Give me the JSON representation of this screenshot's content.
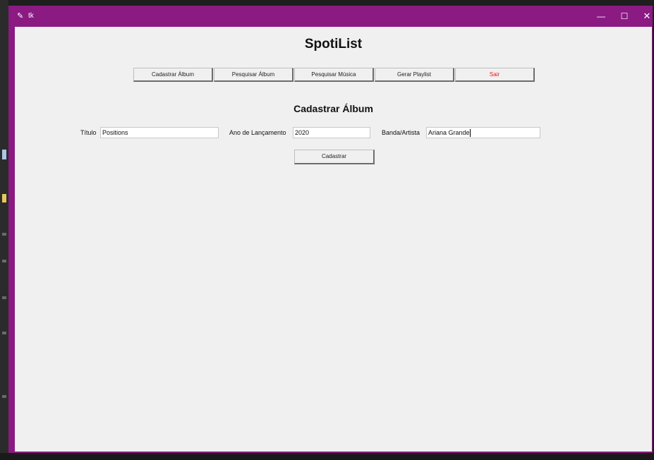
{
  "window": {
    "title": "tk",
    "icon": "feather-icon",
    "controls": {
      "minimize": "—",
      "maximize": "☐",
      "close": "✕"
    },
    "accent": "#8b1a83"
  },
  "app": {
    "title": "SpotiList"
  },
  "nav": {
    "buttons": [
      "Cadastrar Álbum",
      "Pesquisar Álbum",
      "Pesquisar Música",
      "Gerar Playlist",
      "Sair"
    ],
    "exit_color": "#e01818"
  },
  "form": {
    "section_title": "Cadastrar Álbum",
    "fields": [
      {
        "label": "Título",
        "value": "Positions"
      },
      {
        "label": "Ano de Lançamento",
        "value": "2020"
      },
      {
        "label": "Banda/Artista",
        "value": "Ariana Grande"
      }
    ],
    "submit_label": "Cadastrar"
  }
}
